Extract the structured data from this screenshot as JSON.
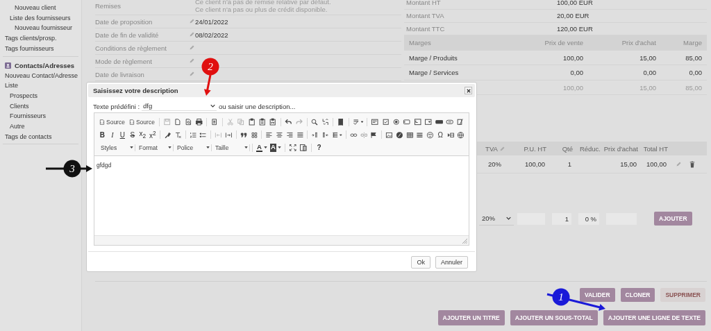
{
  "sidebar": {
    "sections": [
      {
        "items": [
          {
            "children": [
              {
                "children": [
                  {
                    "label": "Nouveau client"
                  }
                ]
              },
              {
                "label": "Liste des fournisseurs",
                "children": [
                  {
                    "label": "Nouveau fournisseur"
                  }
                ]
              }
            ]
          },
          {
            "label": "Tags clients/prosp."
          },
          {
            "label": "Tags fournisseurs"
          }
        ]
      },
      {
        "title": "Contacts/Adresses",
        "items": [
          {
            "label": "Nouveau Contact/Adresse"
          },
          {
            "label": "Liste",
            "children": [
              {
                "label": "Prospects"
              },
              {
                "label": "Clients"
              },
              {
                "label": "Fournisseurs"
              },
              {
                "label": "Autre"
              }
            ]
          },
          {
            "label": "Tags de contacts"
          }
        ]
      }
    ]
  },
  "fields": [
    {
      "label": "Remises",
      "editable": false,
      "values": [
        "Ce client n'a pas de remise relative par défaut.",
        "Ce client n'a pas ou plus de crédit disponible."
      ]
    },
    {
      "label": "Date de proposition",
      "editable": true,
      "values": [
        "24/01/2022"
      ]
    },
    {
      "label": "Date de fin de validité",
      "editable": true,
      "values": [
        "08/02/2022"
      ]
    },
    {
      "label": "Conditions de règlement",
      "editable": true
    },
    {
      "label": "Mode de règlement",
      "editable": true
    },
    {
      "label": "Date de livraison",
      "editable": true
    }
  ],
  "totals": [
    {
      "label": "Montant HT",
      "value": "100,00 EUR"
    },
    {
      "label": "Montant TVA",
      "value": "20,00 EUR"
    },
    {
      "label": "Montant TTC",
      "value": "120,00 EUR"
    }
  ],
  "margins": {
    "columns": [
      "Marges",
      "Prix de vente",
      "Prix d'achat",
      "Marge"
    ],
    "rows": [
      {
        "kind": "line",
        "cells": [
          "Marge / Produits",
          "100,00",
          "15,00",
          "85,00"
        ]
      },
      {
        "kind": "line",
        "cells": [
          "Marge / Services",
          "0,00",
          "0,00",
          "0,00"
        ]
      },
      {
        "kind": "total",
        "cells": [
          "",
          "100,00",
          "15,00",
          "85,00"
        ]
      }
    ]
  },
  "lines": {
    "columns": [
      {
        "label": "TVA",
        "editable": true
      },
      {
        "label": "P.U. HT",
        "editable": false
      },
      {
        "label": "Qté",
        "editable": false
      },
      {
        "label": "Réduc.",
        "editable": false
      },
      {
        "label": "Prix d'achat",
        "editable": false
      },
      {
        "label": "Total HT",
        "editable": false
      }
    ],
    "rows": [
      {
        "vat": "20%",
        "unit_price": "100,00",
        "qty": "1",
        "purchase_price": "15,00",
        "total": "100,00"
      }
    ]
  },
  "add_line": {
    "vat": "20%",
    "qty": "1",
    "discount": "0 %",
    "button": "AJOUTER"
  },
  "actions": [
    {
      "label": "VALIDER",
      "kind": "normal"
    },
    {
      "label": "CLONER",
      "kind": "normal"
    },
    {
      "label": "SUPPRIMER",
      "kind": "danger"
    }
  ],
  "add_buttons": [
    "AJOUTER UN TITRE",
    "AJOUTER UN SOUS-TOTAL",
    "AJOUTER UNE LIGNE DE TEXTE"
  ],
  "dialog": {
    "title": "Saisissez votre description",
    "predefined_label": "Texte prédéfini :",
    "predefined_value": "dfg",
    "alt_text": "ou saisir une description...",
    "toolbar": [
      [
        {
          "kind": "text_button",
          "label": "Source"
        },
        {
          "kind": "text_button",
          "label": "Source"
        },
        {
          "kind": "separator"
        },
        {
          "kind": "icon",
          "disabled": true
        },
        {
          "kind": "icon",
          "disabled": false
        },
        {
          "kind": "icon",
          "disabled": false
        },
        {
          "kind": "icon",
          "disabled": false
        },
        {
          "kind": "separator"
        },
        {
          "kind": "icon",
          "disabled": false
        },
        {
          "kind": "separator"
        },
        {
          "kind": "icon",
          "disabled": true
        },
        {
          "kind": "icon",
          "disabled": true
        },
        {
          "kind": "icon",
          "disabled": false
        },
        {
          "kind": "icon",
          "disabled": false
        },
        {
          "kind": "icon",
          "disabled": false
        },
        {
          "kind": "separator"
        },
        {
          "kind": "icon",
          "disabled": false
        },
        {
          "kind": "icon",
          "disabled": true
        },
        {
          "kind": "separator"
        },
        {
          "kind": "icon",
          "disabled": false
        },
        {
          "kind": "icon",
          "disabled": false
        },
        {
          "kind": "separator"
        },
        {
          "kind": "icon",
          "disabled": false
        },
        {
          "kind": "separator"
        },
        {
          "kind": "icon",
          "disabled": false
        },
        {
          "kind": "separator"
        },
        {
          "kind": "icon",
          "disabled": false
        },
        {
          "kind": "icon",
          "disabled": false
        },
        {
          "kind": "icon",
          "disabled": false
        },
        {
          "kind": "icon",
          "disabled": false
        },
        {
          "kind": "icon",
          "disabled": false
        },
        {
          "kind": "icon",
          "disabled": false
        },
        {
          "kind": "icon",
          "disabled": false
        },
        {
          "kind": "icon",
          "disabled": false
        },
        {
          "kind": "icon",
          "disabled": false
        }
      ],
      [
        {
          "kind": "bold",
          "label": "B"
        },
        {
          "kind": "italic",
          "label": "I"
        },
        {
          "kind": "underline",
          "label": "U"
        },
        {
          "kind": "strike",
          "label": "S"
        },
        {
          "kind": "glyph",
          "label": "x$_{2}$"
        },
        {
          "kind": "glyph",
          "label": "x$^{2}$"
        },
        {
          "kind": "separator"
        },
        {
          "kind": "icon",
          "disabled": false
        },
        {
          "kind": "icon",
          "disabled": false
        },
        {
          "kind": "separator"
        },
        {
          "kind": "icon",
          "disabled": false
        },
        {
          "kind": "icon",
          "disabled": false
        },
        {
          "kind": "separator"
        },
        {
          "kind": "icon",
          "disabled": true
        },
        {
          "kind": "icon",
          "disabled": false
        },
        {
          "kind": "separator"
        },
        {
          "kind": "icon",
          "disabled": false
        },
        {
          "kind": "icon",
          "disabled": false
        },
        {
          "kind": "separator"
        },
        {
          "kind": "icon",
          "disabled": false
        },
        {
          "kind": "icon",
          "disabled": false
        },
        {
          "kind": "icon",
          "disabled": false
        },
        {
          "kind": "icon",
          "disabled": false
        },
        {
          "kind": "separator"
        },
        {
          "kind": "icon",
          "disabled": false
        },
        {
          "kind": "icon",
          "disabled": false
        },
        {
          "kind": "icon",
          "disabled": false
        },
        {
          "kind": "separator"
        },
        {
          "kind": "icon",
          "disabled": false
        },
        {
          "kind": "icon",
          "disabled": true
        },
        {
          "kind": "icon",
          "disabled": false
        },
        {
          "kind": "separator"
        },
        {
          "kind": "icon",
          "disabled": false
        },
        {
          "kind": "icon",
          "disabled": false
        },
        {
          "kind": "icon",
          "disabled": false
        },
        {
          "kind": "icon",
          "disabled": false
        },
        {
          "kind": "icon",
          "disabled": false
        },
        {
          "kind": "glyph",
          "label": "Ω"
        },
        {
          "kind": "icon",
          "disabled": false
        },
        {
          "kind": "icon",
          "disabled": false
        }
      ],
      [
        {
          "kind": "combo",
          "label": "Styles"
        },
        {
          "kind": "combo",
          "label": "Format"
        },
        {
          "kind": "combo",
          "label": "Police"
        },
        {
          "kind": "combo",
          "label": "Taille"
        },
        {
          "kind": "separator"
        },
        {
          "kind": "text_color",
          "label": "A"
        },
        {
          "kind": "background_color",
          "label": "A"
        },
        {
          "kind": "separator"
        },
        {
          "kind": "icon",
          "disabled": false
        },
        {
          "kind": "icon",
          "disabled": false
        },
        {
          "kind": "separator"
        },
        {
          "kind": "bold",
          "label": "?"
        }
      ]
    ],
    "content": "gfdgd",
    "buttons": [
      "Ok",
      "Annuler"
    ]
  },
  "annotations": [
    {
      "label": "1",
      "color": "#1a1ad8"
    },
    {
      "label": "2",
      "color": "#e01010"
    },
    {
      "label": "3",
      "color": "#111111"
    }
  ]
}
